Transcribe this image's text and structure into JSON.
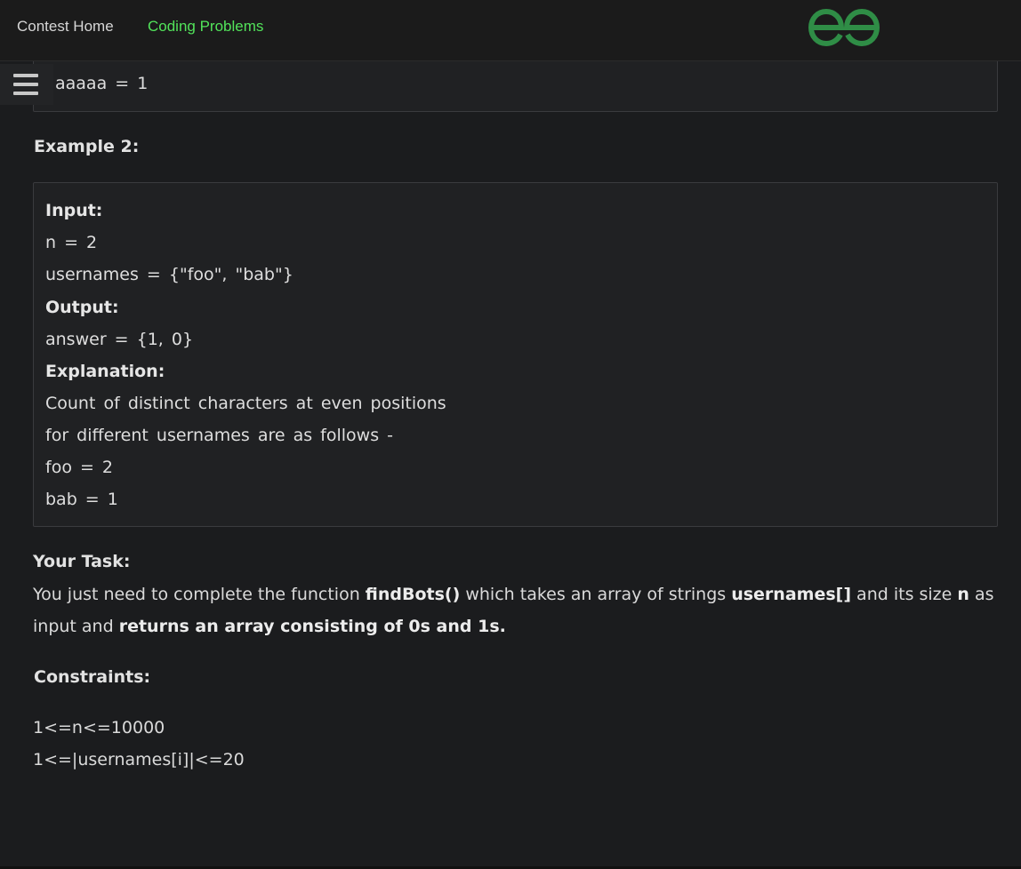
{
  "nav": {
    "contest_home": "Contest Home",
    "coding_problems": "Coding Problems",
    "logo_icon": "geeksforgeeks-logo-icon",
    "menu_icon": "hamburger-menu-icon"
  },
  "colors": {
    "background": "#1b1c1e",
    "active_nav": "#52e35a",
    "logo_green": "#2f8d46",
    "code_box_bg": "#202123",
    "code_box_border": "#3a3b3e"
  },
  "example1": {
    "last_line": "aaaaa = 1"
  },
  "example2": {
    "heading": "Example 2:",
    "input_label": "Input:",
    "input_n": "n = 2",
    "input_usernames": "usernames = {\"foo\", \"bab\"}",
    "output_label": "Output:",
    "output_answer": "answer = {1, 0}",
    "explanation_label": "Explanation:",
    "explanation_line1": "Count of distinct characters at even positions",
    "explanation_line2": "for different usernames are as follows -",
    "explanation_line3": "foo = 2",
    "explanation_line4": "bab = 1"
  },
  "task": {
    "heading": "Your Task:",
    "text_1": "You just need to complete the function ",
    "func_name": "findBots()",
    "text_2": " which takes an array of strings ",
    "arr_name": "usernames[]",
    "text_3": " and its size ",
    "size_name": "n",
    "text_4": " as input and ",
    "returns": "returns an array consisting of 0s and 1s."
  },
  "constraints": {
    "heading": "Constraints:",
    "line1": "1<=n<=10000",
    "line2": "1<=|usernames[i]|<=20"
  }
}
